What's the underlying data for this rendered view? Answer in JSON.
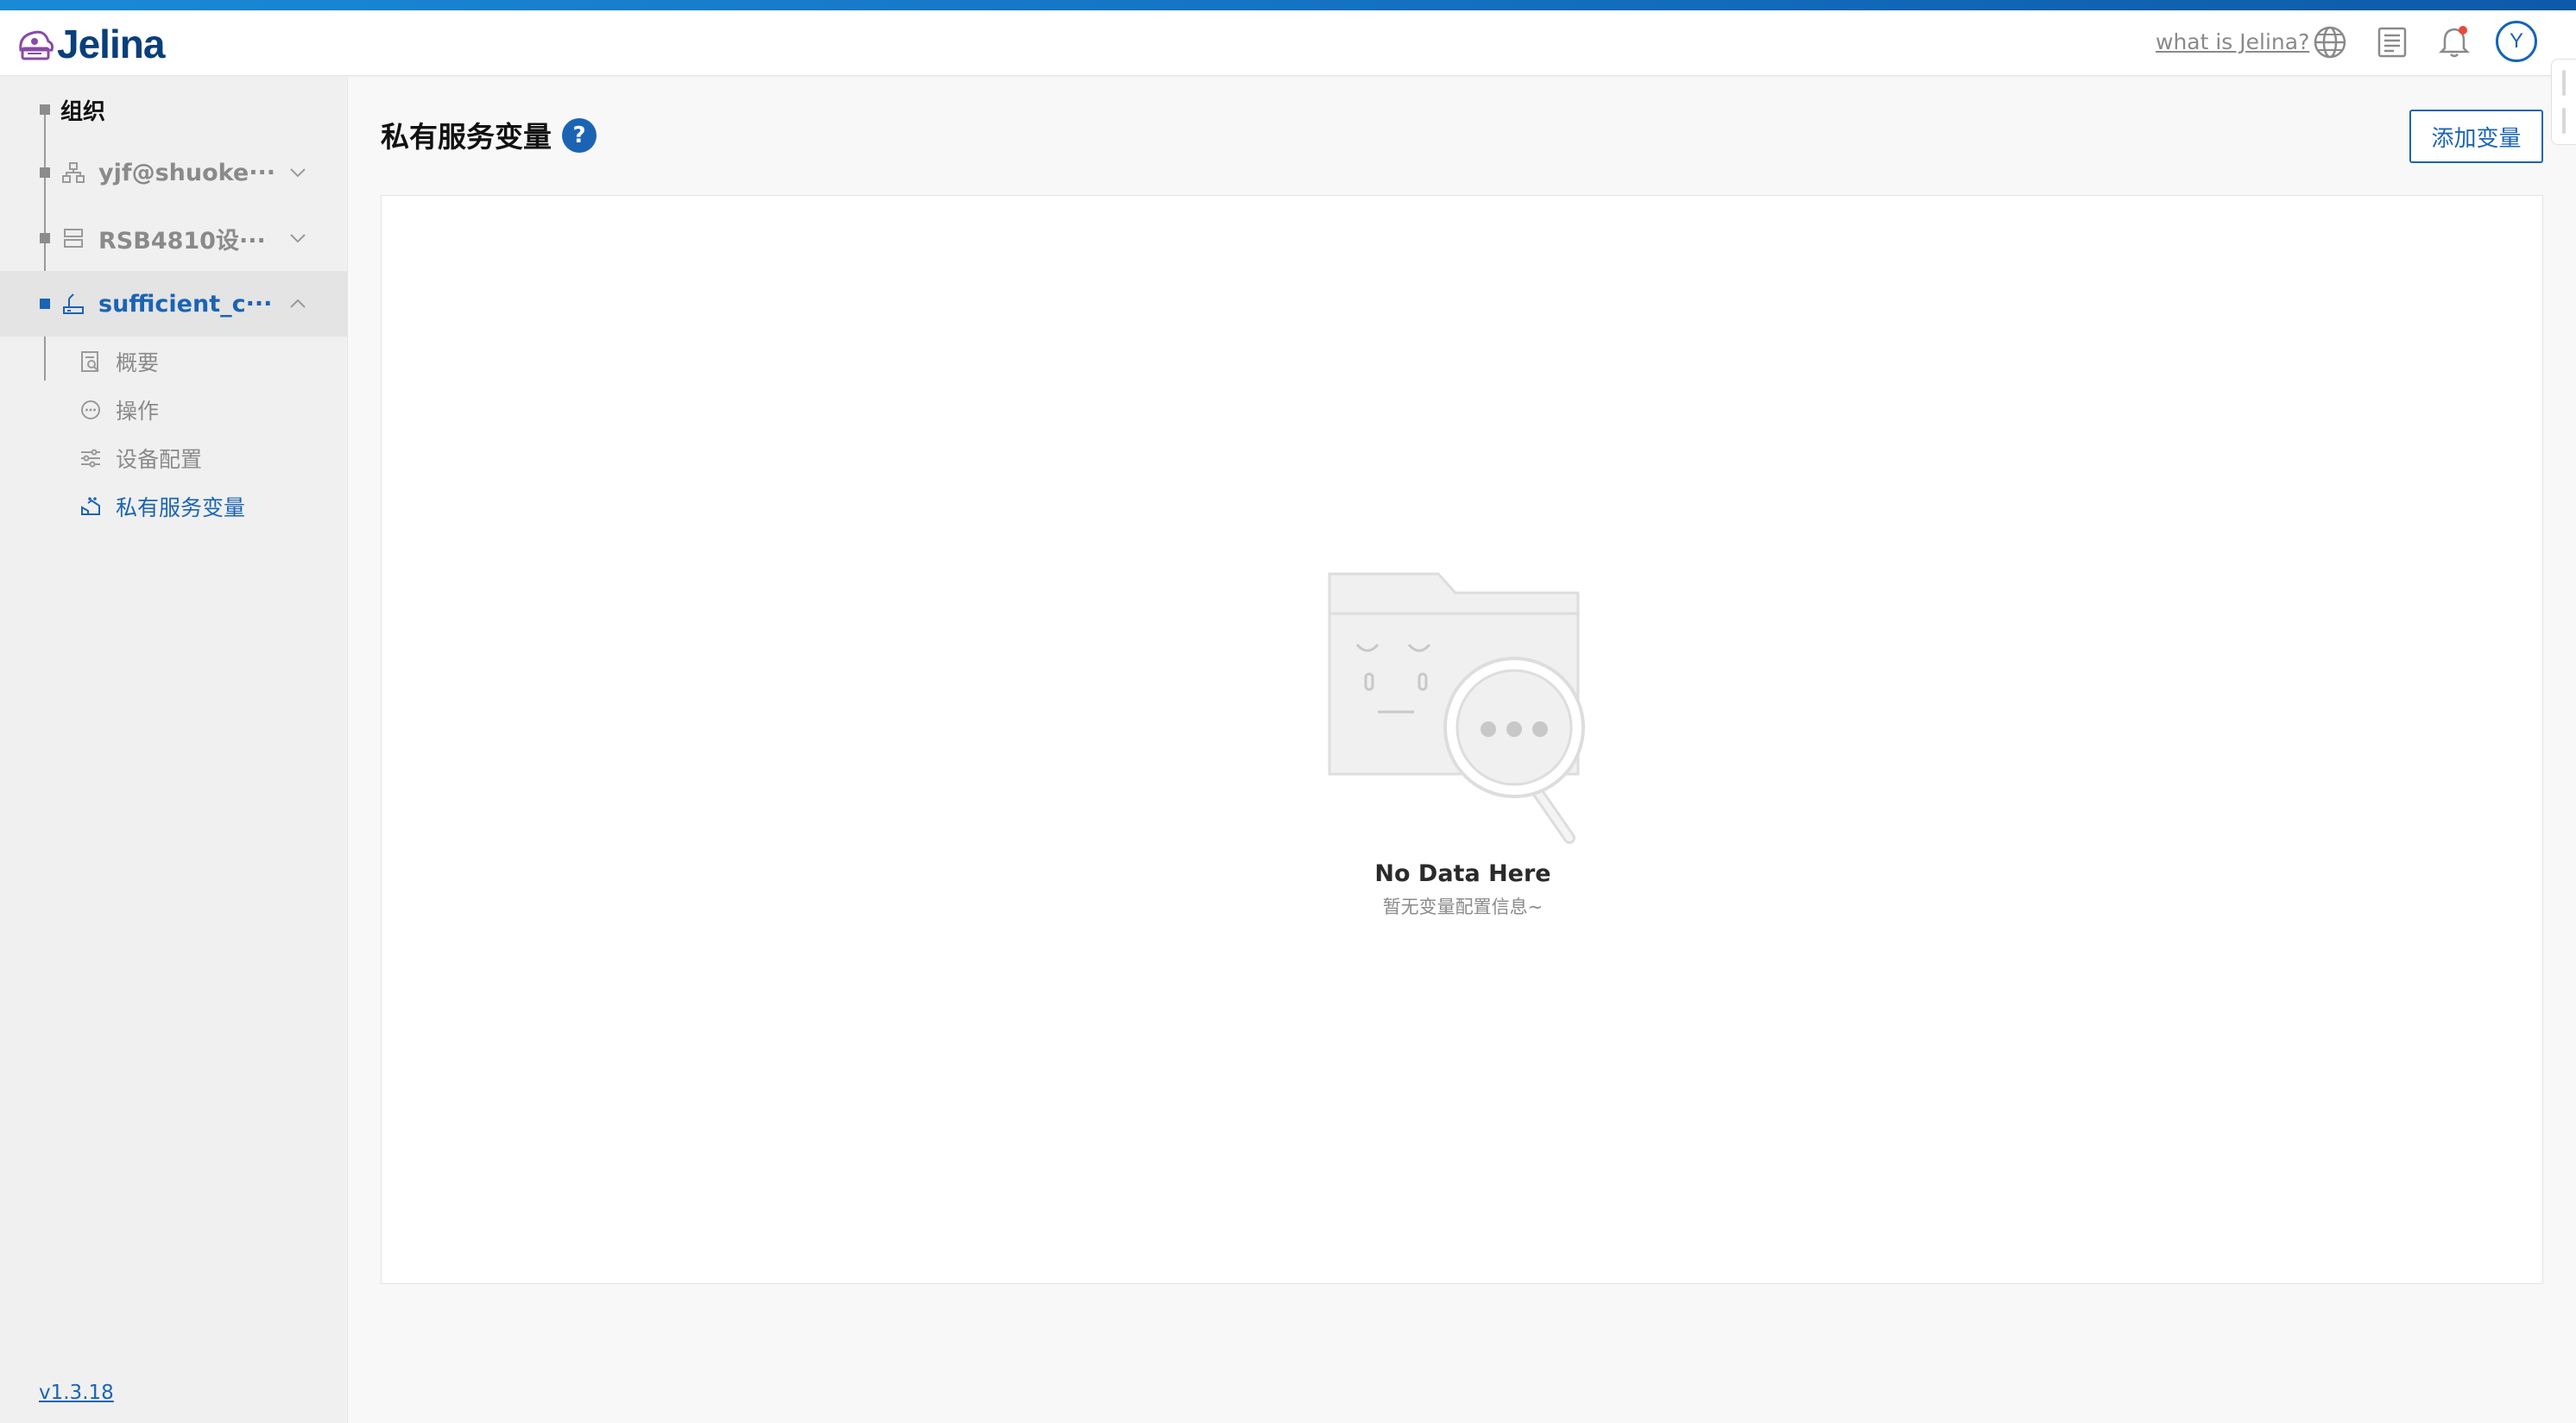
{
  "header": {
    "logo_text": "Jelina",
    "what_link": "what is Jelina?",
    "avatar_initial": "Y"
  },
  "sidebar": {
    "org_label": "组织",
    "nodes": [
      {
        "label": "yjf@shuoke···",
        "icon": "network-icon",
        "expanded": false
      },
      {
        "label": "RSB4810设···",
        "icon": "server-icon",
        "expanded": false
      },
      {
        "label": "sufficient_c···",
        "icon": "device-icon",
        "expanded": true
      }
    ],
    "sub_items": [
      {
        "label": "概要",
        "icon": "overview-icon"
      },
      {
        "label": "操作",
        "icon": "operation-icon"
      },
      {
        "label": "设备配置",
        "icon": "config-icon"
      },
      {
        "label": "私有服务变量",
        "icon": "variable-icon",
        "active": true
      }
    ],
    "version": "v1.3.18"
  },
  "main": {
    "title": "私有服务变量",
    "help": "?",
    "add_button": "添加变量",
    "empty_title": "No Data Here",
    "empty_desc": "暂无变量配置信息~"
  },
  "colors": {
    "accent": "#1b64b4",
    "brand_dark": "#0b3f7a",
    "muted_text": "#8a8a8a",
    "notification": "#e84a3c"
  }
}
